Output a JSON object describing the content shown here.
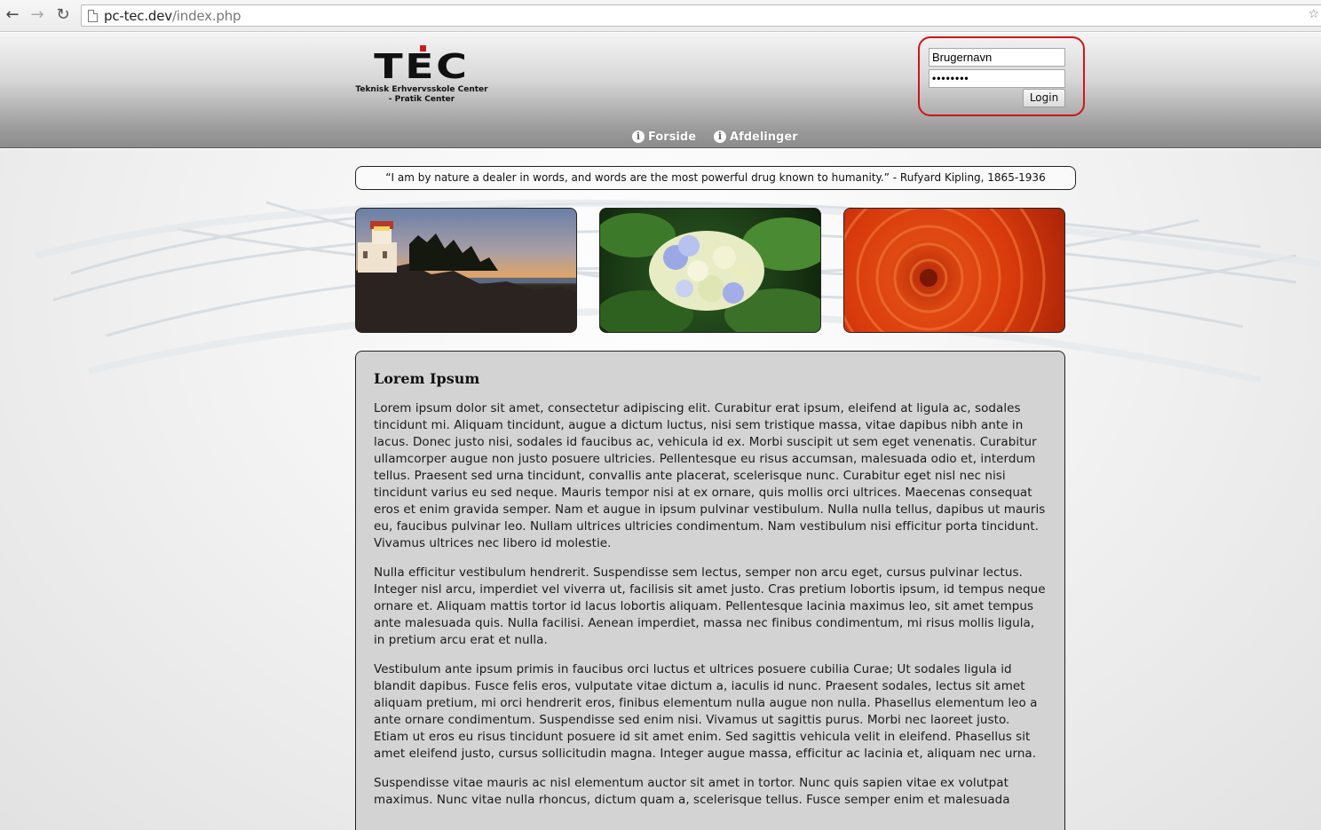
{
  "browser": {
    "url_host": "pc-tec.dev",
    "url_path": "/index.php"
  },
  "header": {
    "logo_text": "TEC",
    "logo_sub_1": "Teknisk Erhvervsskole Center",
    "logo_sub_2": "- Pratik Center",
    "login": {
      "username_value": "Brugernavn",
      "password_value": "••••••••",
      "button_label": "Login"
    },
    "menu": [
      {
        "label": "Forside",
        "icon": "info-icon"
      },
      {
        "label": "Afdelinger",
        "icon": "info-icon"
      }
    ]
  },
  "quote": "“I am by nature a dealer in words, and words are the most powerful drug known to humanity.” - Rufyard Kipling, 1865-1936",
  "photos": [
    {
      "name": "lighthouse-photo"
    },
    {
      "name": "hydrangea-photo"
    },
    {
      "name": "red-flower-photo"
    }
  ],
  "article": {
    "title": "Lorem Ipsum",
    "paragraphs": [
      "Lorem ipsum dolor sit amet, consectetur adipiscing elit. Curabitur erat ipsum, eleifend at ligula ac, sodales tincidunt mi. Aliquam tincidunt, augue a dictum luctus, nisi sem tristique massa, vitae dapibus nibh ante in lacus. Donec justo nisi, sodales id faucibus ac, vehicula id ex. Morbi suscipit ut sem eget venenatis. Curabitur ullamcorper augue non justo posuere ultricies. Pellentesque eu risus accumsan, malesuada odio et, interdum tellus. Praesent sed urna tincidunt, convallis ante placerat, scelerisque nunc. Curabitur eget nisl nec nisi tincidunt varius eu sed neque. Mauris tempor nisi at ex ornare, quis mollis orci ultrices. Maecenas consequat eros et enim gravida semper. Nam et augue in ipsum pulvinar vestibulum. Nulla nulla tellus, dapibus ut mauris eu, faucibus pulvinar leo. Nullam ultrices ultricies condimentum. Nam vestibulum nisi efficitur porta tincidunt. Vivamus ultrices nec libero id molestie.",
      "Nulla efficitur vestibulum hendrerit. Suspendisse sem lectus, semper non arcu eget, cursus pulvinar lectus. Integer nisl arcu, imperdiet vel viverra ut, facilisis sit amet justo. Cras pretium lobortis ipsum, id tempus neque ornare et. Aliquam mattis tortor id lacus lobortis aliquam. Pellentesque lacinia maximus leo, sit amet tempus ante malesuada quis. Nulla facilisi. Aenean imperdiet, massa nec finibus condimentum, mi risus mollis ligula, in pretium arcu erat et nulla.",
      "Vestibulum ante ipsum primis in faucibus orci luctus et ultrices posuere cubilia Curae; Ut sodales ligula id blandit dapibus. Fusce felis eros, vulputate vitae dictum a, iaculis id nunc. Praesent sodales, lectus sit amet aliquam pretium, mi orci hendrerit eros, finibus elementum nulla augue non nulla. Phasellus elementum leo a ante ornare condimentum. Suspendisse sed enim nisi. Vivamus ut sagittis purus. Morbi nec laoreet justo. Etiam ut eros eu risus tincidunt posuere id sit amet enim. Sed sagittis vehicula velit in eleifend. Phasellus sit amet eleifend justo, cursus sollicitudin magna. Integer augue massa, efficitur ac lacinia et, aliquam nec urna.",
      "Suspendisse vitae mauris ac nisl elementum auctor sit amet in tortor. Nunc quis sapien vitae ex volutpat maximus. Nunc vitae nulla rhoncus, dictum quam a, scelerisque tellus. Fusce semper enim et malesuada"
    ]
  },
  "colors": {
    "login_highlight": "#d0141a",
    "content_bg": "#d3d3d3",
    "logo_accent": "#cc1d1d"
  }
}
